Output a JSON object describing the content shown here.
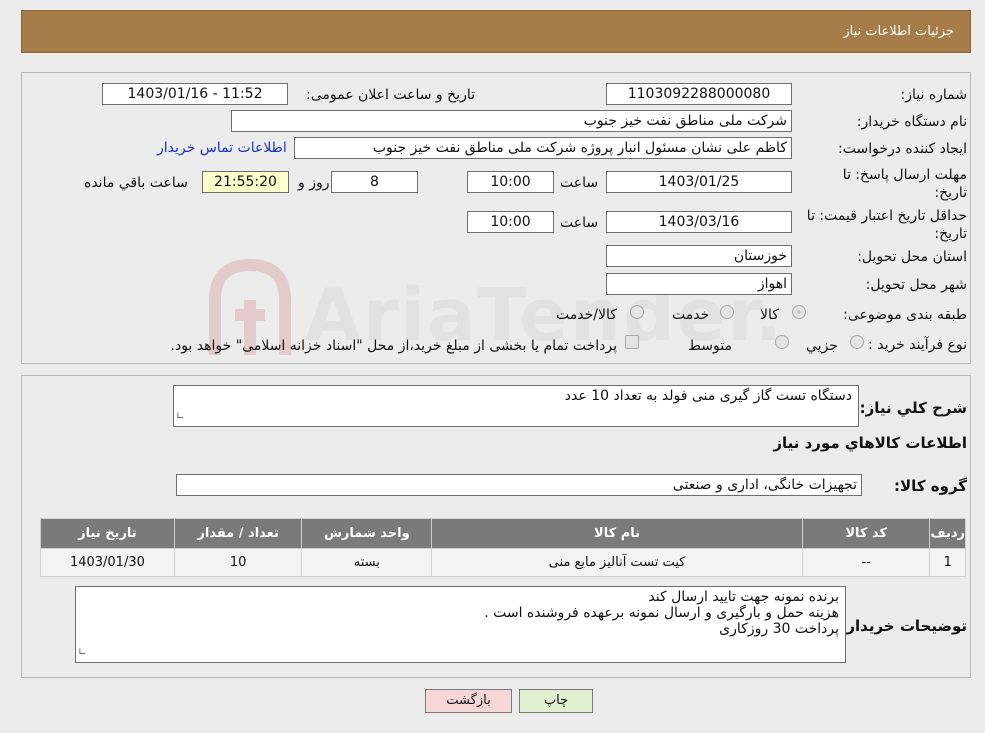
{
  "header": {
    "title": "جزئیات اطلاعات نیاز"
  },
  "watermark": {
    "text": "AriaTender.neT"
  },
  "form": {
    "need_number_label": "شماره نیاز:",
    "need_number": "1103092288000080",
    "announce_label": "تاریخ و ساعت اعلان عمومی:",
    "announce_value": "1403/01/16 - 11:52",
    "buyer_org_label": "نام دستگاه خریدار:",
    "buyer_org": "شرکت ملی مناطق نفت خیز جنوب",
    "creator_label": "ایجاد کننده درخواست:",
    "creator": "کاظم  علی نشان  مسئول انبار پروژه  شرکت ملی مناطق نفت خیز جنوب",
    "contact_link": "اطلاعات تماس خریدار",
    "deadline_label": "مهلت ارسال پاسخ: تا تاریخ:",
    "deadline_date": "1403/01/25",
    "time_label": "ساعت",
    "deadline_time": "10:00",
    "days_value": "8",
    "days_label": "روز و",
    "remaining_time": "21:55:20",
    "remaining_label": "ساعت باقي مانده",
    "validity_label": "حداقل تاریخ اعتبار قیمت: تا تاریخ:",
    "validity_date": "1403/03/16",
    "validity_time": "10:00",
    "province_label": "استان محل تحویل:",
    "province": "خوزستان",
    "city_label": "شهر محل تحویل:",
    "city": "اهواز",
    "category_label": "طبقه بندی موضوعی:",
    "category_options": [
      "کالا",
      "خدمت",
      "کالا/خدمت"
    ],
    "process_label": "نوع فرآیند خرید :",
    "process_options": [
      "جزيي",
      "متوسط"
    ],
    "payment_note": "پرداخت تمام یا بخشی از مبلغ خرید،از محل \"اسناد خزانه اسلامی\" خواهد بود."
  },
  "description": {
    "label": "شرح کلي نياز:",
    "text": "دستگاه تست گاز گیری منی فولد به تعداد 10 عدد"
  },
  "items_section": {
    "title": "اطلاعات کالاهاي مورد نياز",
    "group_label": "گروه کالا:",
    "group_value": "تجهیزات خانگی، اداری و صنعتی",
    "columns": [
      "رديف",
      "کد کالا",
      "نام کالا",
      "واحد شمارش",
      "تعداد / مقدار",
      "تاریخ نیاز"
    ],
    "rows": [
      [
        "1",
        "--",
        "کیت تست آنالیز مایع منی",
        "بسته",
        "10",
        "1403/01/30"
      ]
    ]
  },
  "buyer_notes": {
    "label": "توضیحات خریدار:",
    "lines": [
      "برنده نمونه جهت تایید ارسال کند",
      "هزینه حمل و بارگیری و ارسال نمونه برعهده فروشنده است .",
      "پرداخت 30 روزکاری"
    ]
  },
  "buttons": {
    "print": "چاپ",
    "back": "بازگشت"
  },
  "colors": {
    "header": "#a67c48",
    "table_header": "#7a7a7a",
    "back_button": "#f6d6d6",
    "print_button": "#e0f0d0",
    "timer": "#ffffcc"
  }
}
